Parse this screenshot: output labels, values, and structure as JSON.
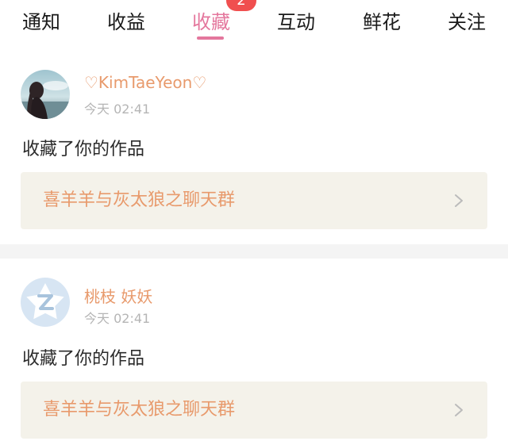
{
  "tabs": [
    {
      "label": "通知"
    },
    {
      "label": "收益"
    },
    {
      "label": "收藏",
      "badge": "2",
      "active": true
    },
    {
      "label": "互动"
    },
    {
      "label": "鲜花"
    },
    {
      "label": "关注"
    }
  ],
  "notifications": [
    {
      "username": "♡KimTaeYeon♡",
      "time": "今天 02:41",
      "action": "收藏了你的作品",
      "work_title": "喜羊羊与灰太狼之聊天群",
      "avatar": "user-photo"
    },
    {
      "username": "桃枝 妖妖",
      "time": "今天 02:41",
      "action": "收藏了你的作品",
      "work_title": "喜羊羊与灰太狼之聊天群",
      "avatar": "default-z-avatar"
    }
  ],
  "colors": {
    "accent": "#e4779d",
    "badge": "#f04f4f",
    "username": "#e89a6c",
    "work_bg": "#f4f2ea"
  },
  "icons": {
    "chevron": "chevron-right-icon"
  }
}
